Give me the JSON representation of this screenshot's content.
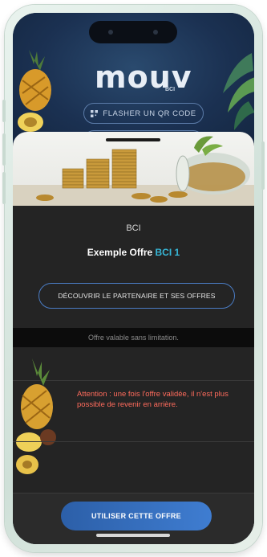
{
  "app": {
    "logo_text": "mouv",
    "logo_sub": "BCI",
    "scan_button_label": "FLASHER UN QR CODE"
  },
  "offer": {
    "brand": "BCI",
    "title_prefix": "Exemple Offre ",
    "title_accent": "BCI 1",
    "partner_button_label": "DÉCOUVRIR LE PARTENAIRE ET SES OFFRES",
    "validity_text": "Offre valable sans limitation.",
    "warning_text": "Attention : une fois l'offre validée, il n'est plus possible de revenir en arrière.",
    "use_button_label": "UTILISER CETTE OFFRE"
  },
  "colors": {
    "accent": "#37b8d8",
    "warning": "#ff6b5c",
    "button_blue": "#3f7dd1",
    "sheet_bg": "#242424"
  },
  "icons": {
    "qr": "qr-code-icon"
  }
}
